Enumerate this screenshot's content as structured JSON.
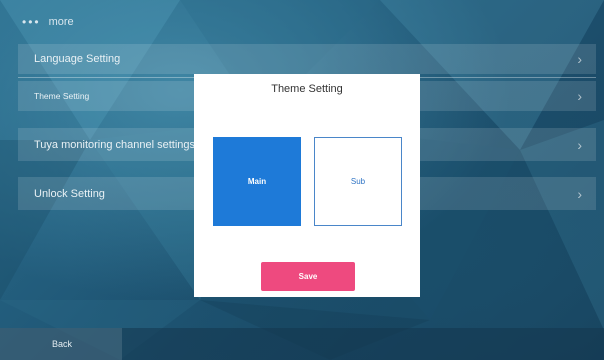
{
  "header": {
    "dots": "•••",
    "title": "more"
  },
  "rows": [
    {
      "label": "Language Setting",
      "chevron": "›"
    },
    {
      "label": "Theme Setting",
      "chevron": "›"
    },
    {
      "label": "Tuya monitoring channel settings",
      "chevron": "›"
    },
    {
      "label": "Unlock Setting",
      "chevron": "›"
    }
  ],
  "footer": {
    "back_label": "Back"
  },
  "dialog": {
    "title": "Theme Setting",
    "options": [
      {
        "label": "Main",
        "selected": true
      },
      {
        "label": "Sub",
        "selected": false
      }
    ],
    "save_label": "Save"
  },
  "colors": {
    "selected_theme": "#1e7ad8",
    "save_button": "#ee4a7f",
    "background": "#1f5675"
  }
}
